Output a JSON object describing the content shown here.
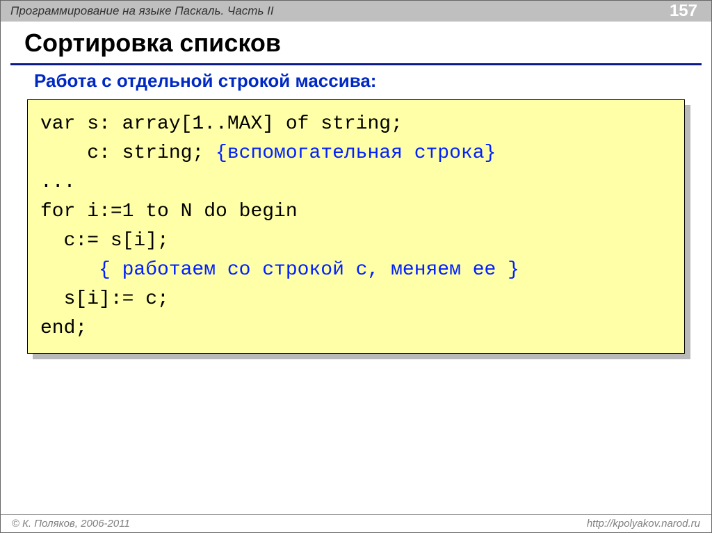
{
  "topbar": {
    "breadcrumb": "Программирование на языке Паскаль. Часть II",
    "page": "157"
  },
  "title": "Сортировка списков",
  "subtitle": "Работа с отдельной строкой массива:",
  "code": {
    "l1a": "var s: array[1..MAX] of string;",
    "l2a": "    c: string; ",
    "l2b": "{вспомогательная строка}",
    "l3": "...",
    "l4": "for i:=1 to N do begin",
    "l5": "  c:= s[i];",
    "l6": "     { работаем со строкой c, меняем ее }",
    "l7": "  s[i]:= c;",
    "l8": "end;"
  },
  "footer": {
    "copyright_symbol": "©",
    "author": "К. Поляков, 2006-2011",
    "url": "http://kpolyakov.narod.ru"
  }
}
